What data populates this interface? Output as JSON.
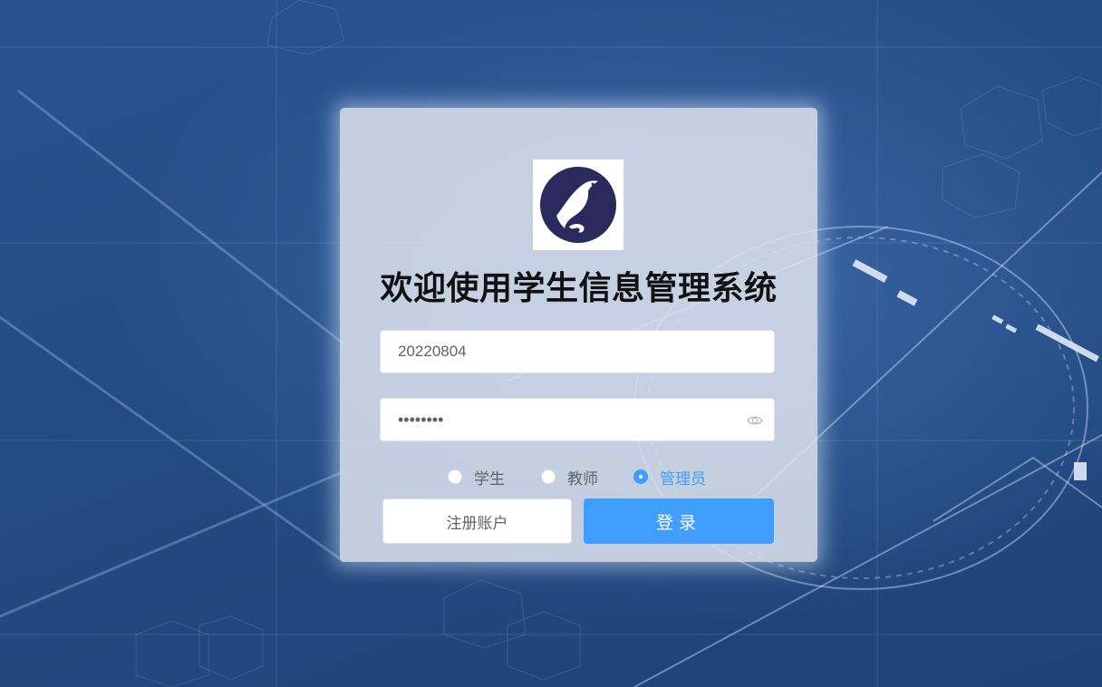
{
  "login": {
    "title": "欢迎使用学生信息管理系统",
    "username": {
      "value": "20220804",
      "placeholder": ""
    },
    "password": {
      "masked_value": "••••••••",
      "type": "password"
    },
    "roles": [
      {
        "label": "学生",
        "checked": false
      },
      {
        "label": "教师",
        "checked": false
      },
      {
        "label": "管理员",
        "checked": true
      }
    ],
    "register_label": "注册账户",
    "login_label": "登录"
  },
  "icons": {
    "logo": "bird-logo-icon",
    "password_toggle": "eye-icon"
  },
  "colors": {
    "primary": "#409eff",
    "logo_circle": "#2b2a5e",
    "background": "#24497f",
    "card": "#dde3ed"
  }
}
